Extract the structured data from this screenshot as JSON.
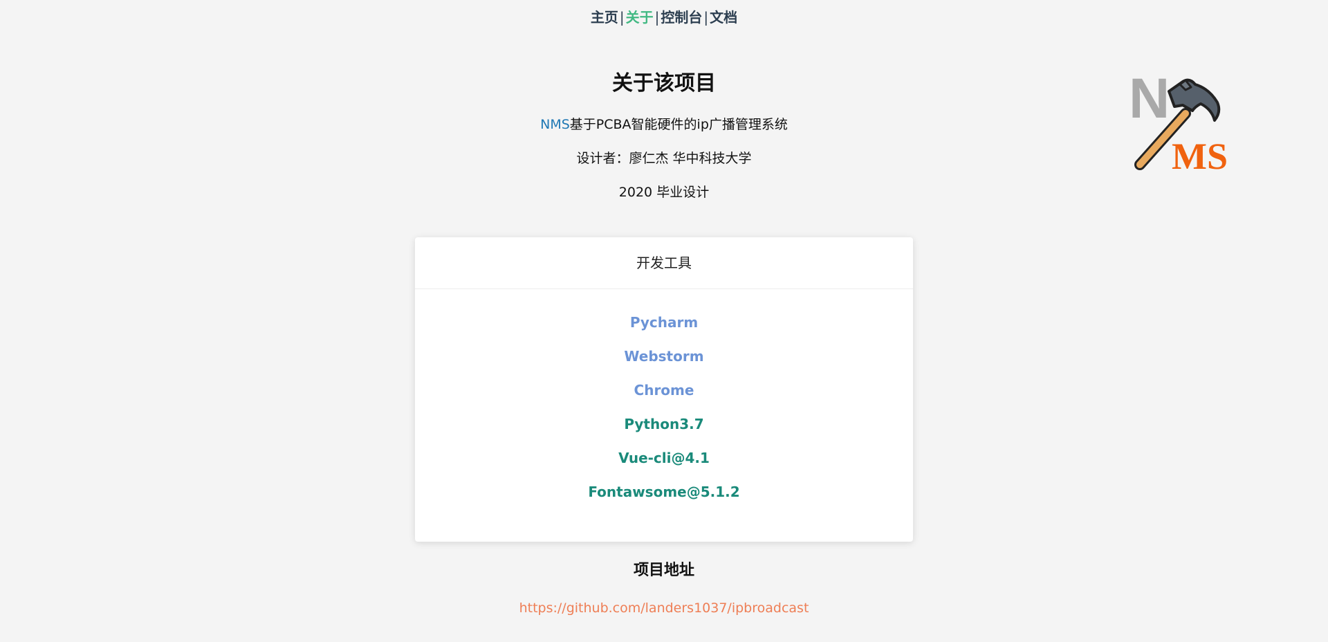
{
  "nav": {
    "items": [
      {
        "label": "主页",
        "active": false
      },
      {
        "label": "关于",
        "active": true
      },
      {
        "label": "控制台",
        "active": false
      },
      {
        "label": "文档",
        "active": false
      }
    ],
    "separator": "|",
    "active_color": "#42b983"
  },
  "logo": {
    "letter_n": "N",
    "letters_ms": "MS",
    "icon": "hammer-icon",
    "ms_color": "#f0620f"
  },
  "about": {
    "title": "关于该项目",
    "brand": "NMS",
    "description": "基于PCBA智能硬件的ip广播管理系统",
    "designer": "设计者：廖仁杰 华中科技大学",
    "year_note": "2020 毕业设计"
  },
  "tools_card": {
    "header": "开发工具",
    "tools": [
      {
        "label": "Pycharm",
        "kind": "ide"
      },
      {
        "label": "Webstorm",
        "kind": "ide"
      },
      {
        "label": "Chrome",
        "kind": "ide"
      },
      {
        "label": "Python3.7",
        "kind": "lib"
      },
      {
        "label": "Vue-cli@4.1",
        "kind": "lib"
      },
      {
        "label": "Fontawsome@5.1.2",
        "kind": "lib"
      }
    ]
  },
  "repo": {
    "heading": "项目地址",
    "link": "https://github.com/landers1037/ipbroadcast",
    "link_color": "#ee7e55"
  }
}
